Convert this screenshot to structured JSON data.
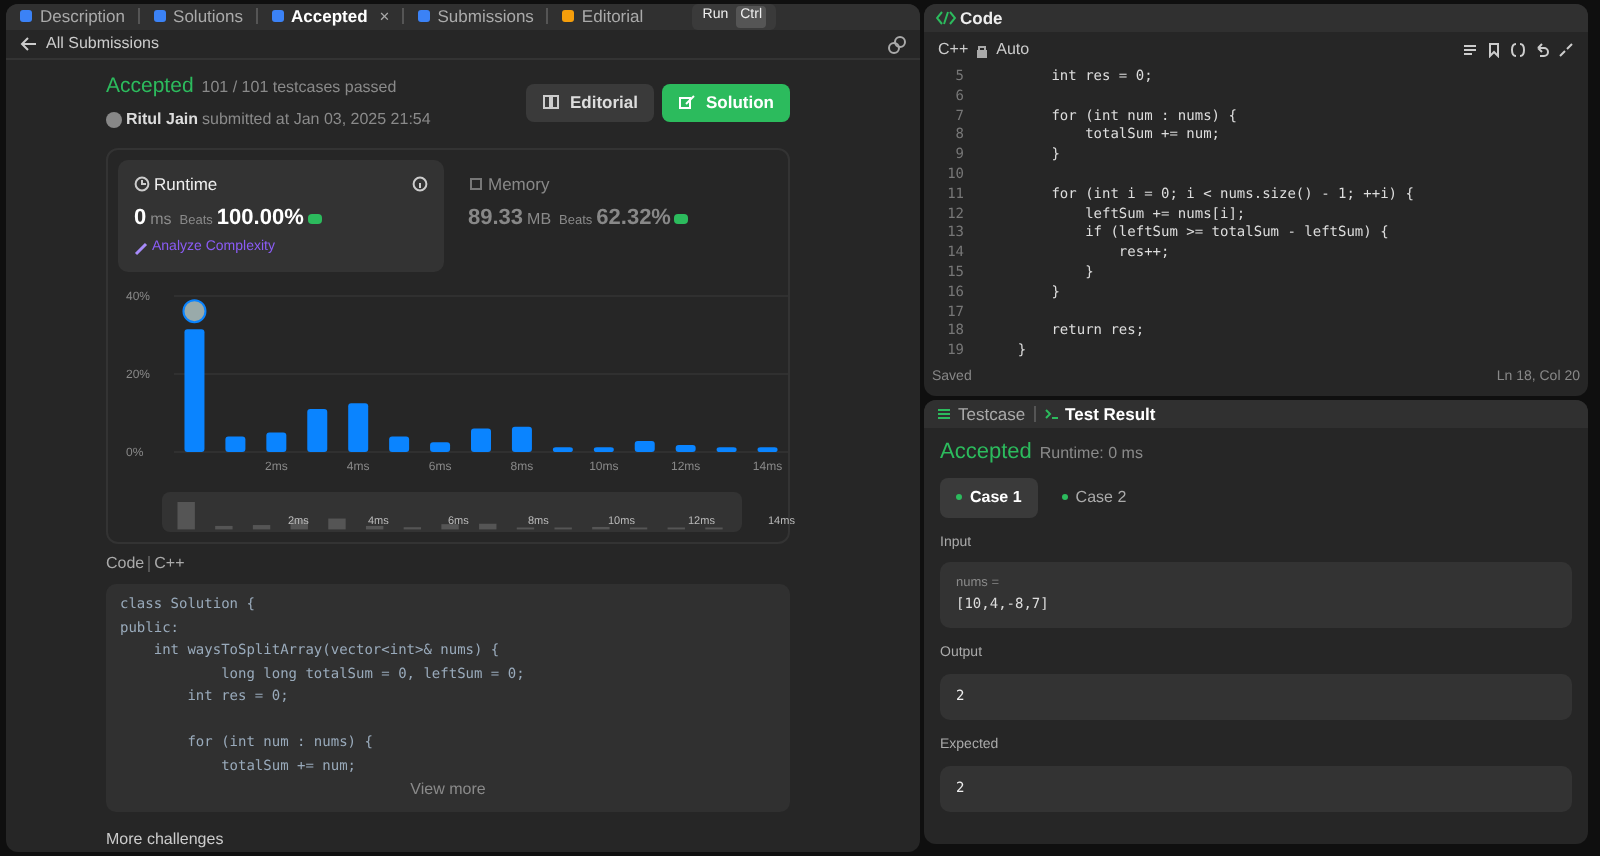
{
  "tabs": [
    {
      "label": "Description",
      "selected": false,
      "color": "#3b82f6"
    },
    {
      "label": "Solutions",
      "selected": false,
      "color": "#3b82f6"
    },
    {
      "label": "Accepted",
      "selected": true,
      "close": "×",
      "color": "#3b82f6"
    },
    {
      "label": "Submissions",
      "selected": false,
      "color": "#3b82f6"
    },
    {
      "label": "Editorial",
      "selected": false,
      "color": "#f59e0b"
    }
  ],
  "run_button": {
    "label": "Run",
    "shortcut": "Ctrl"
  },
  "back_link": "All Submissions",
  "submission": {
    "status": "Accepted",
    "testcases": "101 / 101 testcases passed",
    "user": "Ritul Jain",
    "submitted": "submitted at Jan 03, 2025 21:54"
  },
  "buttons": [
    {
      "label": "Editorial",
      "kind": "secondary"
    },
    {
      "label": "Solution",
      "kind": "primary"
    }
  ],
  "metrics": [
    {
      "title": "Runtime",
      "value": "0",
      "unit": "ms",
      "beats_label": "Beats",
      "beats": "100.00%",
      "selected": true
    },
    {
      "title": "Memory",
      "value": "89.33",
      "unit": "MB",
      "beats_label": "Beats",
      "beats": "62.32%",
      "selected": false
    }
  ],
  "analyze_link": "Analyze Complexity",
  "chart_data": {
    "type": "bar",
    "x": [
      0,
      1,
      2,
      3,
      4,
      5,
      6,
      7,
      8,
      9,
      10,
      11,
      12,
      13,
      14
    ],
    "values": [
      31.5,
      4,
      5,
      11,
      12.5,
      4,
      2.5,
      6,
      6.5,
      1.2,
      1.2,
      2.8,
      1.8,
      1.2,
      1.2
    ],
    "xlim": [
      -0.5,
      14.5
    ],
    "ylim": [
      0,
      40
    ],
    "yticks": [
      {
        "value": 0,
        "label": "0%"
      },
      {
        "value": 20,
        "label": "20%"
      },
      {
        "value": 40,
        "label": "40%"
      }
    ],
    "xticks": [
      {
        "value": 2,
        "label": "2ms"
      },
      {
        "value": 4,
        "label": "4ms"
      },
      {
        "value": 6,
        "label": "6ms"
      },
      {
        "value": 8,
        "label": "8ms"
      },
      {
        "value": 10,
        "label": "10ms"
      },
      {
        "value": 12,
        "label": "12ms"
      },
      {
        "value": 14,
        "label": "14ms"
      }
    ]
  },
  "navigator_labels": [
    "2ms",
    "4ms",
    "6ms",
    "8ms",
    "10ms",
    "12ms",
    "14ms"
  ],
  "code_header": {
    "label": "Code",
    "language": "C++"
  },
  "code_preview": [
    {
      "text": "class Solution {"
    },
    {
      "text": "public:"
    },
    {
      "text": "    int waysToSplitArray(vector<int>& nums) {"
    },
    {
      "text": "            long long totalSum = 0, leftSum = 0;"
    },
    {
      "text": "        int res = 0;"
    },
    {
      "kind": "blank"
    },
    {
      "text": "        for (int num : nums) {"
    },
    {
      "text": "            totalSum += num;"
    }
  ],
  "view_more": "View more",
  "more_challenges": "More challenges",
  "editor": {
    "title": "Code",
    "language": "C++",
    "mode": "Auto",
    "lines": [
      {
        "number": "5",
        "text": "        int res = 0;"
      },
      {
        "number": "6"
      },
      {
        "number": "7",
        "text": "        for (int num : nums) {"
      },
      {
        "number": "8",
        "text": "            totalSum += num;"
      },
      {
        "number": "9",
        "text": "        }"
      },
      {
        "number": "10"
      },
      {
        "number": "11",
        "text": "        for (int i = 0; i < nums.size() - 1; ++i) {"
      },
      {
        "number": "12",
        "text": "            leftSum += nums[i];"
      },
      {
        "number": "13",
        "text": "            if (leftSum >= totalSum - leftSum) {"
      },
      {
        "number": "14",
        "text": "                res++;"
      },
      {
        "number": "15",
        "text": "            }"
      },
      {
        "number": "16",
        "text": "        }"
      },
      {
        "number": "17"
      },
      {
        "number": "18",
        "text": "        return res;"
      },
      {
        "number": "19",
        "text": "    }"
      }
    ],
    "status": "Saved",
    "cursor": "Ln 18, Col 20"
  },
  "result_tabs": [
    {
      "label": "Testcase",
      "selected": false
    },
    {
      "label": "Test Result",
      "selected": true
    }
  ],
  "result": {
    "status": "Accepted",
    "runtime": "Runtime: 0 ms",
    "cases": [
      {
        "label": "Case 1",
        "selected": true
      },
      {
        "label": "Case 2",
        "selected": false
      }
    ],
    "input_label": "Input",
    "param": "nums =",
    "input": "[10,4,-8,7]",
    "output_label": "Output",
    "output": "2",
    "expected_label": "Expected",
    "expected": "2"
  }
}
